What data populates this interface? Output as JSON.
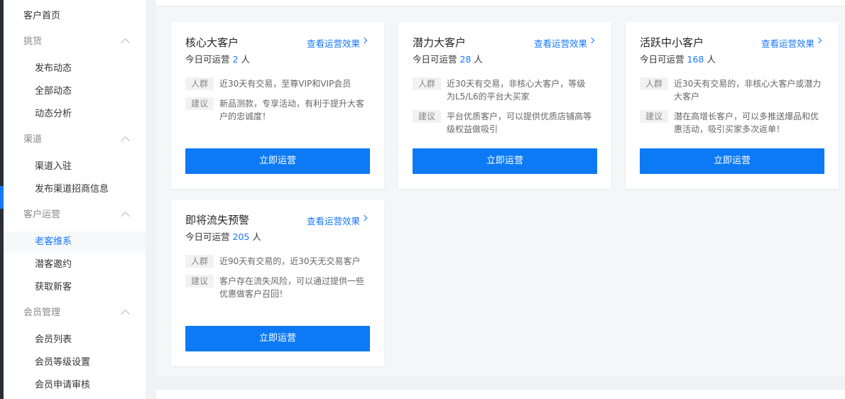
{
  "sidebar": {
    "home": "客户首页",
    "groups": [
      {
        "label": "挑货",
        "items": [
          "发布动态",
          "全部动态",
          "动态分析"
        ]
      },
      {
        "label": "渠道",
        "items": [
          "渠道入驻",
          "发布渠道招商信息"
        ]
      },
      {
        "label": "客户运营",
        "items": [
          "老客维系",
          "潜客邀约",
          "获取新客"
        ]
      },
      {
        "label": "会员管理",
        "items": [
          "会员列表",
          "会员等级设置",
          "会员申请审核"
        ]
      }
    ],
    "active_item": "老客维系"
  },
  "cards": [
    {
      "title": "核心大客户",
      "link": "查看运营效果",
      "today_label": "今日可运营",
      "count": "2",
      "unit": "人",
      "crowd_tag": "人群",
      "crowd_text": "近30天有交易，至尊VIP和VIP会员",
      "advice_tag": "建议",
      "advice_text": "新品测款，专享活动，有利于提升大客户的忠诚度！",
      "button": "立即运营"
    },
    {
      "title": "潜力大客户",
      "link": "查看运营效果",
      "today_label": "今日可运营",
      "count": "28",
      "unit": "人",
      "crowd_tag": "人群",
      "crowd_text": "近30天有交易，非核心大客户，等级为L5/L6的平台大买家",
      "advice_tag": "建议",
      "advice_text": "平台优质客户，可以提供优质店铺高等级权益做吸引",
      "button": "立即运营"
    },
    {
      "title": "活跃中小客户",
      "link": "查看运营效果",
      "today_label": "今日可运营",
      "count": "168",
      "unit": "人",
      "crowd_tag": "人群",
      "crowd_text": "近30天有交易的，非核心大客户或潜力大客户",
      "advice_tag": "建议",
      "advice_text": "潜在高增长客户，可以多推送爆品和优惠活动，吸引买家多次返单！",
      "button": "立即运营"
    },
    {
      "title": "即将流失预警",
      "link": "查看运营效果",
      "today_label": "今日可运营",
      "count": "205",
      "unit": "人",
      "crowd_tag": "人群",
      "crowd_text": "近90天有交易的，近30天无交易客户",
      "advice_tag": "建议",
      "advice_text": "客户存在流失风险，可以通过提供一些优惠做客户召回！",
      "button": "立即运营"
    }
  ],
  "colors": {
    "accent": "#1677ff",
    "button": "#0d7af5",
    "sidebar_rail": "#2b2f3a"
  }
}
